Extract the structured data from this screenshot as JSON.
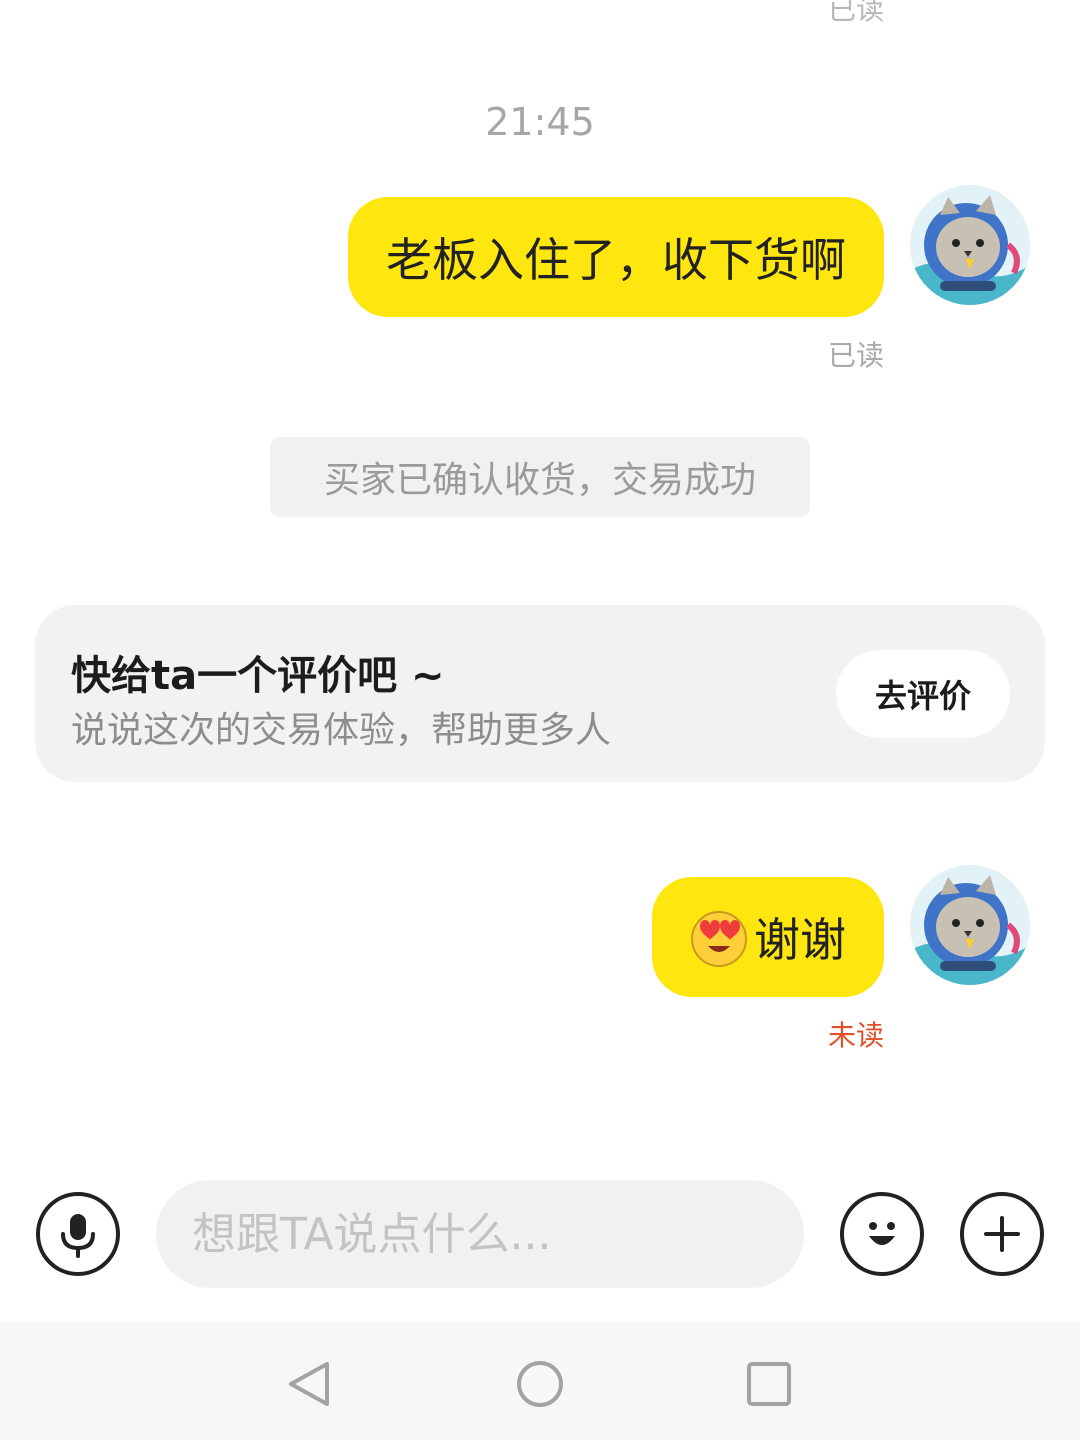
{
  "chat": {
    "top_read_status": "已读",
    "timestamp": "21:45",
    "message1": {
      "text": "老板入住了，收下货啊",
      "status": "已读"
    },
    "system_notice": "买家已确认收货，交易成功",
    "review": {
      "title": "快给ta一个评价吧 ~",
      "subtitle": "说说这次的交易体验，帮助更多人",
      "button_label": "去评价"
    },
    "message2": {
      "emoji": "heart-eyes-face-icon",
      "text": "谢谢",
      "status": "未读"
    }
  },
  "input": {
    "placeholder": "想跟TA说点什么..."
  },
  "icons": {
    "voice": "microphone-icon",
    "emoji": "smiley-icon",
    "more": "plus-icon",
    "nav_back": "triangle-back-icon",
    "nav_home": "circle-home-icon",
    "nav_recent": "square-recents-icon"
  },
  "colors": {
    "bubble": "#ffe60f",
    "unread": "#e0502a"
  }
}
